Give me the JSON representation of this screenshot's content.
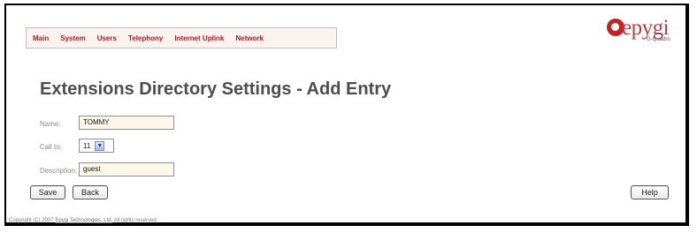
{
  "navigation": {
    "items": [
      {
        "label": "Main"
      },
      {
        "label": "System"
      },
      {
        "label": "Users"
      },
      {
        "label": "Telephony"
      },
      {
        "label": "Internet Uplink"
      },
      {
        "label": "Network"
      }
    ]
  },
  "brand": {
    "logo_text": "epygi",
    "sub_text": "G-Quadro"
  },
  "page": {
    "title": "Extensions Directory Settings - Add Entry"
  },
  "form": {
    "name_label": "Name:",
    "name_value": "TOMMY",
    "call_to_label": "Call to:",
    "call_to_value": "11",
    "description_label": "Description:",
    "description_value": "guest"
  },
  "buttons": {
    "save": "Save",
    "back": "Back",
    "help": "Help"
  },
  "footer": {
    "prefix": "Copyright (C) 2007 ",
    "company": "Epygi Technologies, Ltd.",
    "suffix": " All rights reserved."
  },
  "colors": {
    "nav_text": "#b31717",
    "field_background": "#fff8ea",
    "title_text": "#4d4d4d",
    "logo_red": "#c52121"
  }
}
